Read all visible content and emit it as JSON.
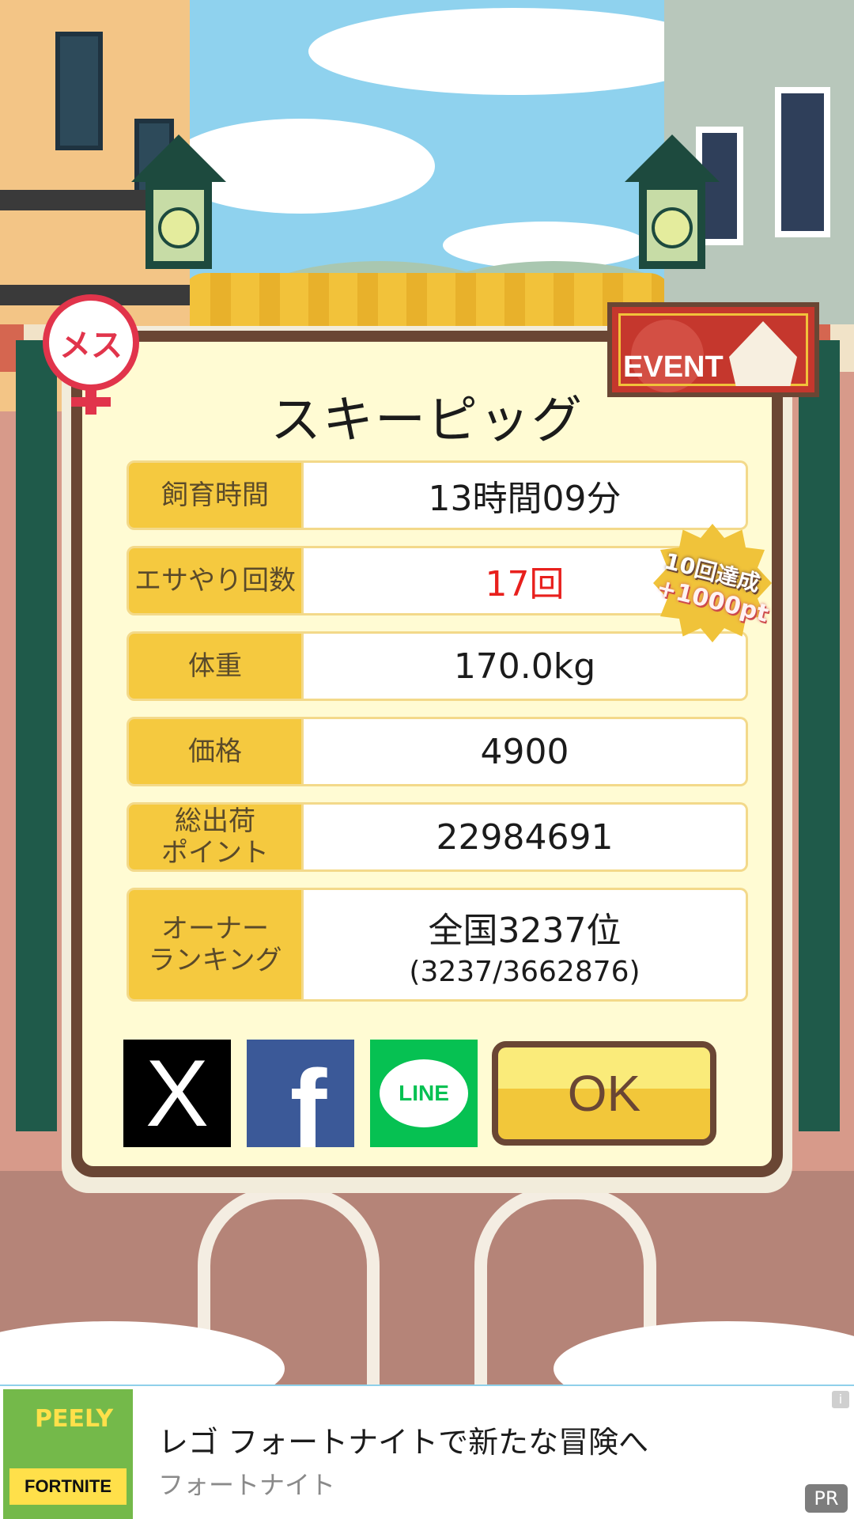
{
  "dialog": {
    "title": "スキーピッグ",
    "rows": [
      {
        "label": "飼育時間",
        "value": "13時間09分"
      },
      {
        "label": "エサやり回数",
        "value": "17回"
      },
      {
        "label": "体重",
        "value": "170.0kg"
      },
      {
        "label": "価格",
        "value": "4900"
      },
      {
        "label": "総出荷\nポイント",
        "value": "22984691"
      },
      {
        "label": "オーナー\nランキング",
        "value": "全国3237位",
        "sub": "(3237/3662876)"
      }
    ],
    "badge": {
      "line1": "10回達成",
      "line2": "+1000pt"
    },
    "ok_label": "OK"
  },
  "gender_badge": {
    "text": "メス",
    "icon": "female-symbol-icon"
  },
  "event_banner": {
    "label": "EVENT",
    "icon": "circus-tent-icon"
  },
  "share": {
    "x": {
      "glyph": "X",
      "icon": "x-logo-icon"
    },
    "facebook": {
      "glyph": "f",
      "icon": "facebook-logo-icon"
    },
    "line": {
      "glyph": "LINE",
      "icon": "line-logo-icon"
    }
  },
  "ad": {
    "title": "レゴ フォートナイトで新たな冒険へ",
    "advertiser": "フォートナイト",
    "pr_label": "PR",
    "info_glyph": "i",
    "thumb_text": "PEELY",
    "thumb_logo": "FORTNITE"
  },
  "colors": {
    "value_red": "#e8201d",
    "label_bg": "#f5c93f",
    "frame": "#6a4634",
    "dialog_bg": "#fffbd3"
  }
}
